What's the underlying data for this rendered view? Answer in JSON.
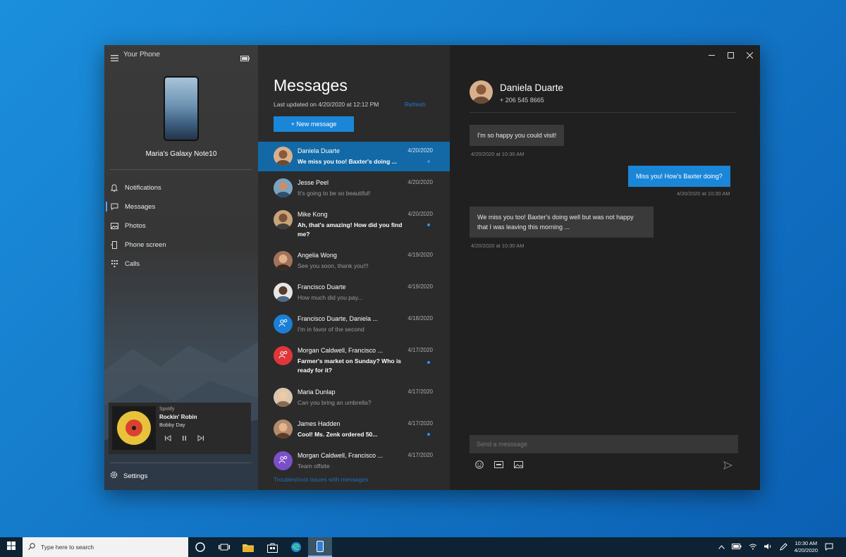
{
  "nav": {
    "app_title": "Your Phone",
    "phone_name": "Maria's Galaxy Note10",
    "items": [
      {
        "label": "Notifications",
        "icon": "bell-icon"
      },
      {
        "label": "Messages",
        "icon": "message-icon"
      },
      {
        "label": "Photos",
        "icon": "photo-icon"
      },
      {
        "label": "Phone screen",
        "icon": "phone-screen-icon"
      },
      {
        "label": "Calls",
        "icon": "dialpad-icon"
      }
    ],
    "active_index": 1,
    "music": {
      "source": "Spotify",
      "title": "Rockin' Robin",
      "artist": "Bobby Day"
    },
    "settings_label": "Settings"
  },
  "list": {
    "title": "Messages",
    "updated": "Last updated on 4/20/2020 at 12:12 PM",
    "refresh": "Refresh",
    "new_message": "+ New message",
    "conversations": [
      {
        "name": "Daniela Duarte",
        "date": "4/20/2020",
        "preview": "We miss you too! Baxter's doing ...",
        "unread": true,
        "selected": true
      },
      {
        "name": "Jesse Peel",
        "date": "4/20/2020",
        "preview": "It's going to be so beautiful!",
        "unread": false
      },
      {
        "name": "Mike Kong",
        "date": "4/20/2020",
        "preview": "Ah, that's amazing! How did you find me?",
        "unread": true
      },
      {
        "name": "Angelia Wong",
        "date": "4/19/2020",
        "preview": "See you soon, thank you!!!",
        "unread": false
      },
      {
        "name": "Francisco Duarte",
        "date": "4/19/2020",
        "preview": "How much did you pay...",
        "unread": false
      },
      {
        "name": "Francisco Duarte, Daniela ...",
        "date": "4/18/2020",
        "preview": "I'm in favor of the second",
        "unread": false
      },
      {
        "name": "Morgan Caldwell, Francisco ...",
        "date": "4/17/2020",
        "preview": "Farmer's market on Sunday? Who is ready for it?",
        "unread": true
      },
      {
        "name": "Maria Dunlap",
        "date": "4/17/2020",
        "preview": "Can you bring an umbrella?",
        "unread": false
      },
      {
        "name": "James Hadden",
        "date": "4/17/2020",
        "preview": "Cool! Ms. Zenk ordered 50...",
        "unread": true
      },
      {
        "name": "Morgan Caldwell, Francisco ...",
        "date": "4/17/2020",
        "preview": "Team offsite",
        "unread": false
      }
    ],
    "troubleshoot": "Troubleshoot issues with messages"
  },
  "conversation": {
    "contact_name": "Daniela Duarte",
    "contact_phone": "+ 206 545 8665",
    "messages": [
      {
        "dir": "in",
        "text": "I'm so happy you could visit!",
        "time": "4/20/2020 at 10:30 AM"
      },
      {
        "dir": "out",
        "text": "Miss you! How's Baxter doing?",
        "time": "4/20/2020 at 10:30 AM"
      },
      {
        "dir": "in",
        "text": "We miss you too! Baxter's doing well but was not happy that I was leaving this morning ...",
        "time": "4/20/2020 at 10:30 AM"
      }
    ],
    "compose_placeholder": "Send a messsage"
  },
  "taskbar": {
    "search_placeholder": "Type here to search",
    "time": "10:30 AM",
    "date": "4/20/2020"
  },
  "colors": {
    "accent": "#1a86d8",
    "selected_row": "#1269a6",
    "window_bg": "#202020"
  }
}
